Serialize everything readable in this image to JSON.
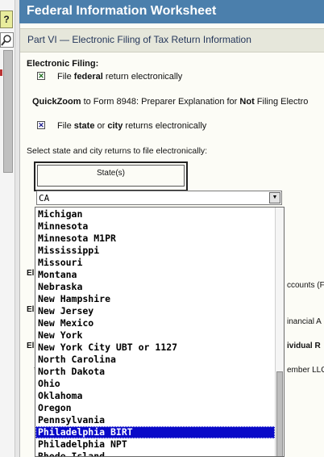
{
  "toolbar": {
    "help_label": "?"
  },
  "window": {
    "title": "Federal Information Worksheet"
  },
  "part": {
    "header": "Part VI — Electronic Filing of Tax Return Information"
  },
  "efile": {
    "section_label": "Electronic Filing:",
    "federal_check": "✕",
    "federal_text_pre": "File ",
    "federal_text_bold": "federal",
    "federal_text_post": " return electronically",
    "quickzoom_bold": "QuickZoom",
    "quickzoom_text": " to Form 8948: Preparer Explanation for ",
    "quickzoom_not": "Not",
    "quickzoom_text2": " Filing Electro",
    "state_check": "✕",
    "state_text_pre": "File ",
    "state_text_bold1": "state",
    "state_text_mid": " or ",
    "state_text_bold2": "city",
    "state_text_post": " returns electronically",
    "select_prompt": "Select state and city returns to file electronically:",
    "state_col_header": "State(s)"
  },
  "combo": {
    "value": "CA"
  },
  "behind": {
    "el1": "El",
    "ccounts": "ccounts (F",
    "el2": "El",
    "financial": "inancial A",
    "el3": "El",
    "ividual": "ividual R",
    "mark": "*",
    "ember": "ember LLC"
  },
  "dropdown": {
    "items": [
      "Michigan",
      "Minnesota",
      "Minnesota M1PR",
      "Mississippi",
      "Missouri",
      "Montana",
      "Nebraska",
      "New Hampshire",
      "New Jersey",
      "New Mexico",
      "New York",
      "New York City UBT or 1127",
      "North Carolina",
      "North Dakota",
      "Ohio",
      "Oklahoma",
      "Oregon",
      "Pennsylvania",
      "Philadelphia BIRT",
      "Philadelphia NPT",
      "Rhode Island"
    ],
    "selected": "Philadelphia BIRT"
  },
  "colors": {
    "title_bar": "#4b7fac",
    "selection": "#0a0ac8",
    "part_header_text": "#25375b"
  }
}
